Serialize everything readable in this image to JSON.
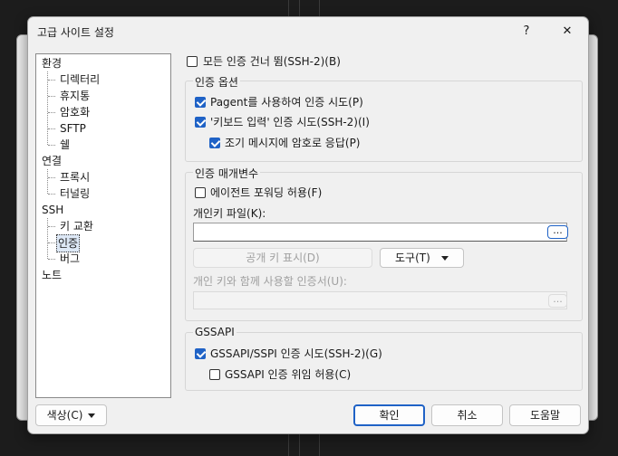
{
  "dialog": {
    "title": "고급 사이트 설정",
    "help": "?",
    "close": "✕"
  },
  "tree": {
    "env": "환경",
    "env_children": [
      "디렉터리",
      "휴지통",
      "암호화",
      "SFTP",
      "쉘"
    ],
    "conn": "연결",
    "conn_children": [
      "프록시",
      "터널링"
    ],
    "ssh": "SSH",
    "ssh_children": [
      "키 교환",
      "인증",
      "버그"
    ],
    "note": "노트",
    "selected": "인증"
  },
  "skip_auth": {
    "label": "모든 인증 건너 뜀(SSH-2)(B)",
    "checked": false
  },
  "auth_options": {
    "title": "인증 옵션",
    "pageant": {
      "label": "Pagent를 사용하여 인증 시도(P)",
      "checked": true
    },
    "keyboard": {
      "label": "'키보드 입력' 인증 시도(SSH-2)(I)",
      "checked": true
    },
    "passcode": {
      "label": "조기 메시지에 암호로 응답(P)",
      "checked": true
    }
  },
  "auth_params": {
    "title": "인증 매개변수",
    "agent_fwd": {
      "label": "에이전트 포워딩 허용(F)",
      "checked": false
    },
    "private_key_label": "개인키 파일(K):",
    "private_key_value": "",
    "browse": "...",
    "show_pubkey": "공개 키 표시(D)",
    "tools": "도구(T)",
    "cert_label": "개인 키와 함께 사용할 인증서(U):",
    "cert_value": "",
    "cert_browse": "..."
  },
  "gssapi": {
    "title": "GSSAPI",
    "sspi": {
      "label": "GSSAPI/SSPI 인증 시도(SSH-2)(G)",
      "checked": true
    },
    "delegation": {
      "label": "GSSAPI 인증 위임 허용(C)",
      "checked": false
    }
  },
  "footer": {
    "color": "색상(C)",
    "ok": "확인",
    "cancel": "취소",
    "help": "도움말"
  },
  "colors": {
    "accent": "#1f62c6"
  }
}
